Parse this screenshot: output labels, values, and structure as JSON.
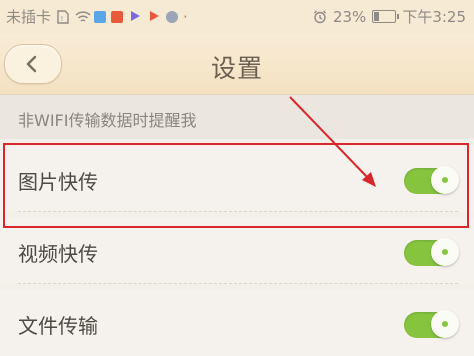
{
  "status_bar": {
    "carrier": "未插卡",
    "battery_percent": "23%",
    "battery_level": 0.23,
    "time": "下午3:25",
    "notification_colors": [
      "#5aa4e8",
      "#e85a3c",
      "#7a6be0",
      "#9aa5b8"
    ]
  },
  "header": {
    "back_icon": "chevron-left-icon",
    "title": "设置"
  },
  "section": {
    "label": "非WIFI传输数据时提醒我"
  },
  "settings": [
    {
      "label": "图片快传",
      "enabled": true
    },
    {
      "label": "视频快传",
      "enabled": true
    },
    {
      "label": "文件传输",
      "enabled": true
    }
  ],
  "colors": {
    "accent_green": "#86c43f",
    "annotation_red": "#d8262b",
    "header_bg": "#f7ead5"
  }
}
